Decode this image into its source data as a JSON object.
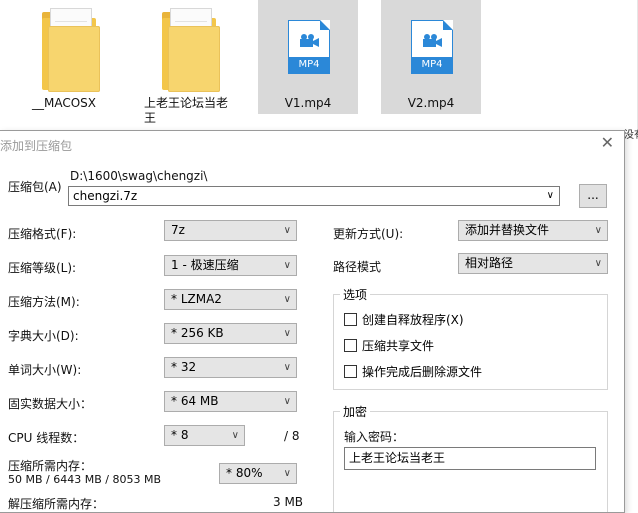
{
  "desktop": {
    "files": [
      {
        "label": "__MACOSX",
        "type": "folder",
        "selected": false
      },
      {
        "label": "上老王论坛当老王",
        "type": "folder",
        "selected": false
      },
      {
        "label": "V1.mp4",
        "type": "mp4",
        "selected": true,
        "badge": "MP4"
      },
      {
        "label": "V2.mp4",
        "type": "mp4",
        "selected": true,
        "badge": "MP4"
      }
    ],
    "edge_text": "没有"
  },
  "dialog": {
    "title": "添加到压缩包",
    "close_glyph": "✕",
    "archive_label": "压缩包(A)",
    "archive_path": "D:\\1600\\swag\\chengzi\\",
    "archive_name": "chengzi.7z",
    "browse_label": "...",
    "format_label": "压缩格式(F):",
    "format_value": "7z",
    "level_label": "压缩等级(L):",
    "level_value": "1 - 极速压缩",
    "method_label": "压缩方法(M):",
    "method_value": "* LZMA2",
    "dict_label": "字典大小(D):",
    "dict_value": "* 256 KB",
    "word_label": "单词大小(W):",
    "word_value": "* 32",
    "solid_label": "固实数据大小：",
    "solid_value": "* 64 MB",
    "cpu_label": "CPU 线程数：",
    "cpu_value": "* 8",
    "cpu_total": "/ 8",
    "mem_comp_label": "压缩所需内存：",
    "mem_comp_value": "50 MB / 6443 MB / 8053 MB",
    "mem_comp_percent": "* 80%",
    "mem_decomp_label": "解压缩所需内存：",
    "mem_decomp_value": "3 MB",
    "update_label": "更新方式(U):",
    "update_value": "添加并替换文件",
    "path_mode_label": "路径模式",
    "path_mode_value": "相对路径",
    "options_title": "选项",
    "options": [
      {
        "label": "创建自释放程序(X)",
        "checked": false
      },
      {
        "label": "压缩共享文件",
        "checked": false
      },
      {
        "label": "操作完成后删除源文件",
        "checked": false
      }
    ],
    "encrypt_title": "加密",
    "password_label": "输入密码：",
    "password_value": "上老王论坛当老王",
    "dropdown_arrow": "∨"
  }
}
